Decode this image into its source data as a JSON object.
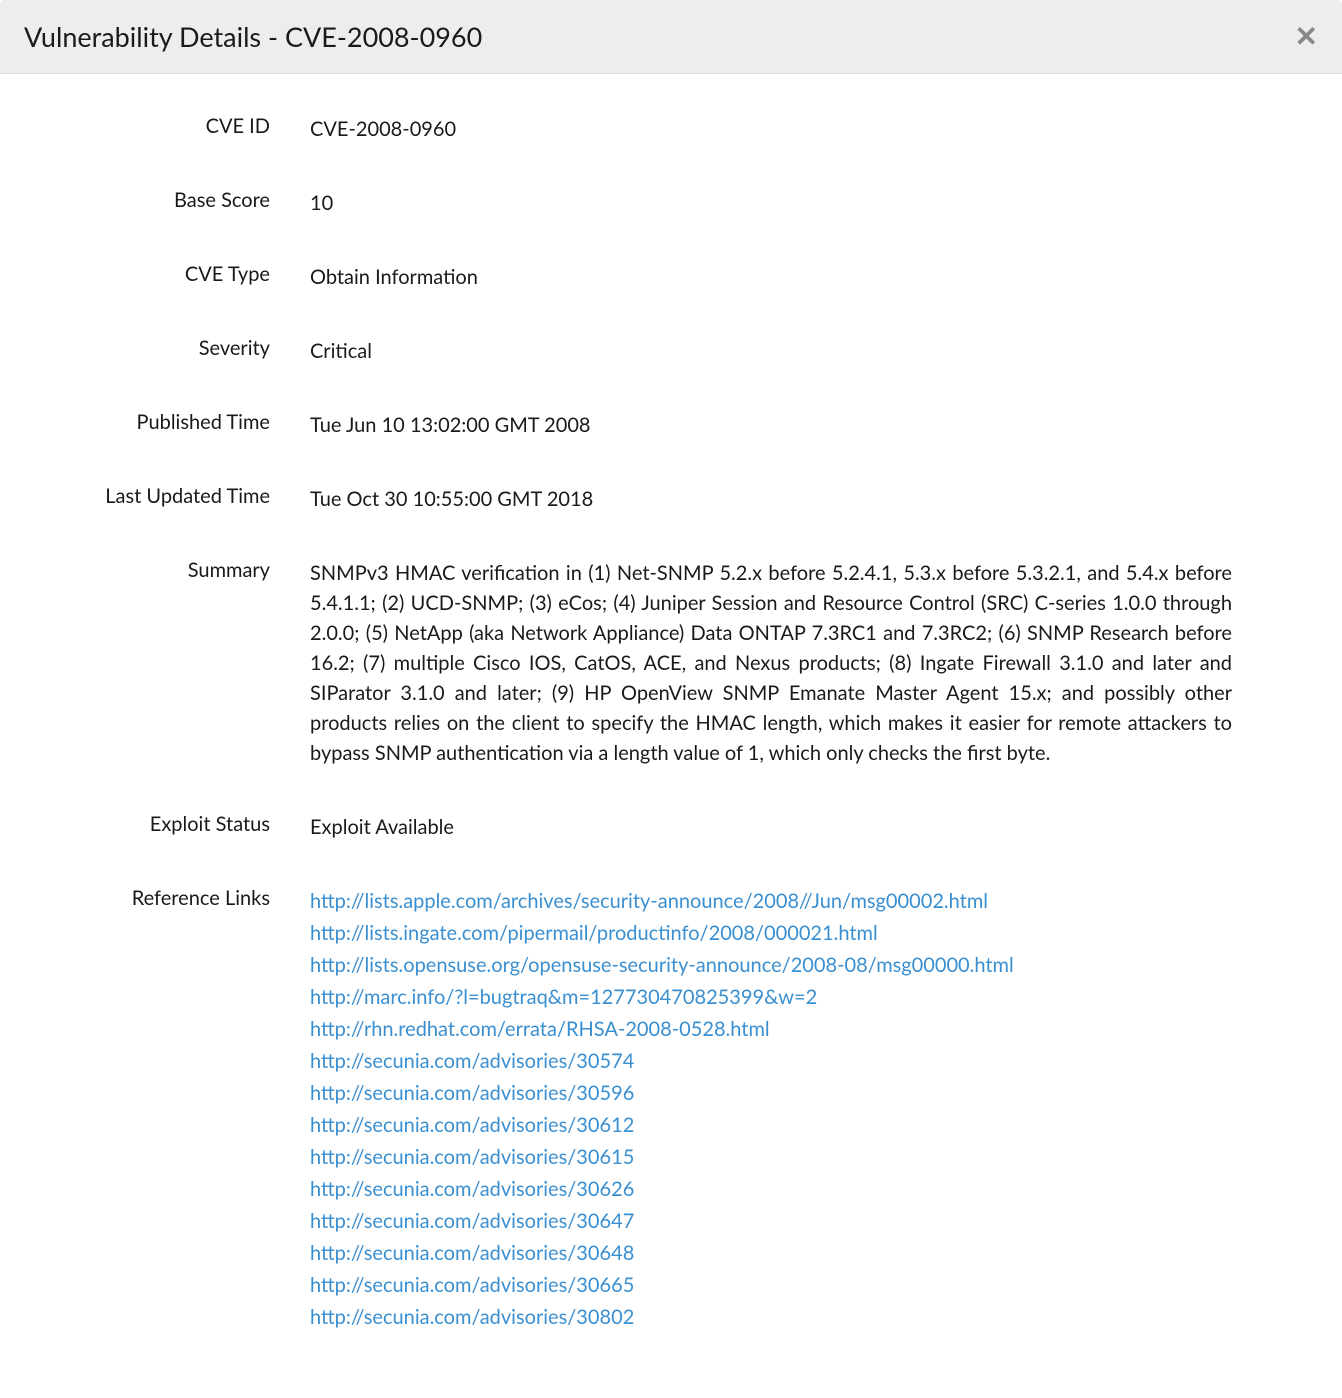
{
  "header": {
    "title": "Vulnerability Details - CVE-2008-0960"
  },
  "labels": {
    "cve_id": "CVE ID",
    "base_score": "Base Score",
    "cve_type": "CVE Type",
    "severity": "Severity",
    "published_time": "Published Time",
    "last_updated_time": "Last Updated Time",
    "summary": "Summary",
    "exploit_status": "Exploit Status",
    "reference_links": "Reference Links"
  },
  "values": {
    "cve_id": "CVE-2008-0960",
    "base_score": "10",
    "cve_type": "Obtain Information",
    "severity": "Critical",
    "published_time": "Tue Jun 10 13:02:00 GMT 2008",
    "last_updated_time": "Tue Oct 30 10:55:00 GMT 2018",
    "summary": "SNMPv3 HMAC verification in (1) Net-SNMP 5.2.x before 5.2.4.1, 5.3.x before 5.3.2.1, and 5.4.x before 5.4.1.1; (2) UCD-SNMP; (3) eCos; (4) Juniper Session and Resource Control (SRC) C-series 1.0.0 through 2.0.0; (5) NetApp (aka Network Appliance) Data ONTAP 7.3RC1 and 7.3RC2; (6) SNMP Research before 16.2; (7) multiple Cisco IOS, CatOS, ACE, and Nexus products; (8) Ingate Firewall 3.1.0 and later and SIParator 3.1.0 and later; (9) HP OpenView SNMP Emanate Master Agent 15.x; and possibly other products relies on the client to specify the HMAC length, which makes it easier for remote attackers to bypass SNMP authentication via a length value of 1, which only checks the first byte.",
    "exploit_status": "Exploit Available"
  },
  "reference_links": [
    "http://lists.apple.com/archives/security-announce/2008//Jun/msg00002.html",
    "http://lists.ingate.com/pipermail/productinfo/2008/000021.html",
    "http://lists.opensuse.org/opensuse-security-announce/2008-08/msg00000.html",
    "http://marc.info/?l=bugtraq&m=127730470825399&w=2",
    "http://rhn.redhat.com/errata/RHSA-2008-0528.html",
    "http://secunia.com/advisories/30574",
    "http://secunia.com/advisories/30596",
    "http://secunia.com/advisories/30612",
    "http://secunia.com/advisories/30615",
    "http://secunia.com/advisories/30626",
    "http://secunia.com/advisories/30647",
    "http://secunia.com/advisories/30648",
    "http://secunia.com/advisories/30665",
    "http://secunia.com/advisories/30802"
  ]
}
